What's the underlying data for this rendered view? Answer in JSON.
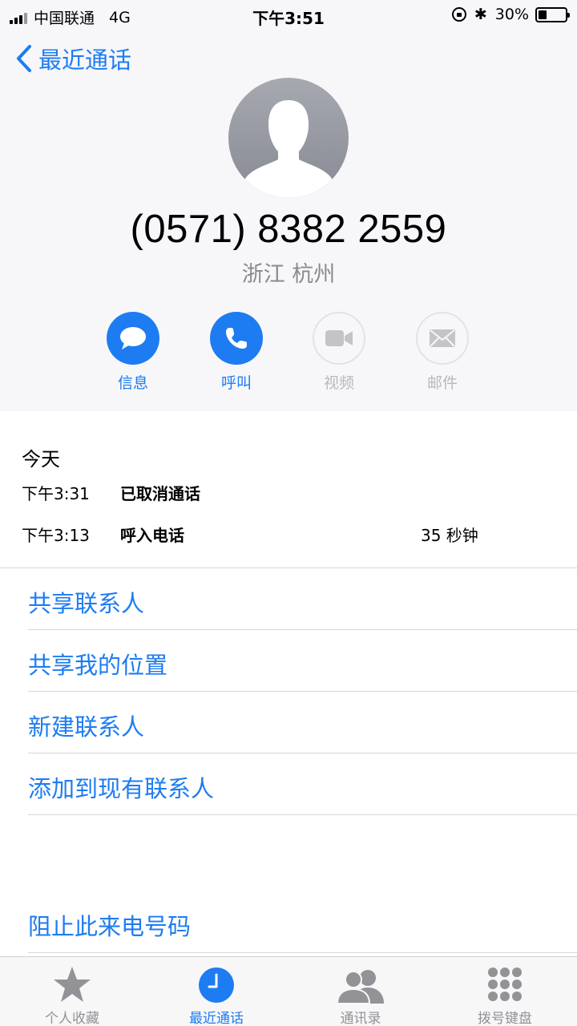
{
  "status_bar": {
    "carrier": "中国联通",
    "network": "4G",
    "time": "下午3:51",
    "battery": "30%",
    "battery_level": 0.3
  },
  "nav": {
    "back_label": "最近通话"
  },
  "contact": {
    "number": "(0571) 8382 2559",
    "location": "浙江 杭州"
  },
  "actions": [
    {
      "label": "信息",
      "icon": "message-bubble-icon",
      "enabled": true
    },
    {
      "label": "呼叫",
      "icon": "phone-icon",
      "enabled": true
    },
    {
      "label": "视频",
      "icon": "video-camera-icon",
      "enabled": false
    },
    {
      "label": "邮件",
      "icon": "envelope-icon",
      "enabled": false
    }
  ],
  "history": {
    "day": "今天",
    "calls": [
      {
        "time": "下午3:31",
        "type": "已取消通话",
        "duration": ""
      },
      {
        "time": "下午3:13",
        "type": "呼入电话",
        "duration": "35 秒钟"
      }
    ]
  },
  "options": [
    "共享联系人",
    "共享我的位置",
    "新建联系人",
    "添加到现有联系人"
  ],
  "block_label": "阻止此来电号码",
  "tabs": [
    {
      "label": "个人收藏",
      "icon": "star-icon",
      "selected": false
    },
    {
      "label": "最近通话",
      "icon": "clock-icon",
      "selected": true
    },
    {
      "label": "通讯录",
      "icon": "contacts-icon",
      "selected": false
    },
    {
      "label": "拨号键盘",
      "icon": "keypad-icon",
      "selected": false
    }
  ],
  "colors": {
    "accent": "#1d7cf2",
    "disabled": "#b8b8bd",
    "secondary_text": "#8a8a8f"
  }
}
